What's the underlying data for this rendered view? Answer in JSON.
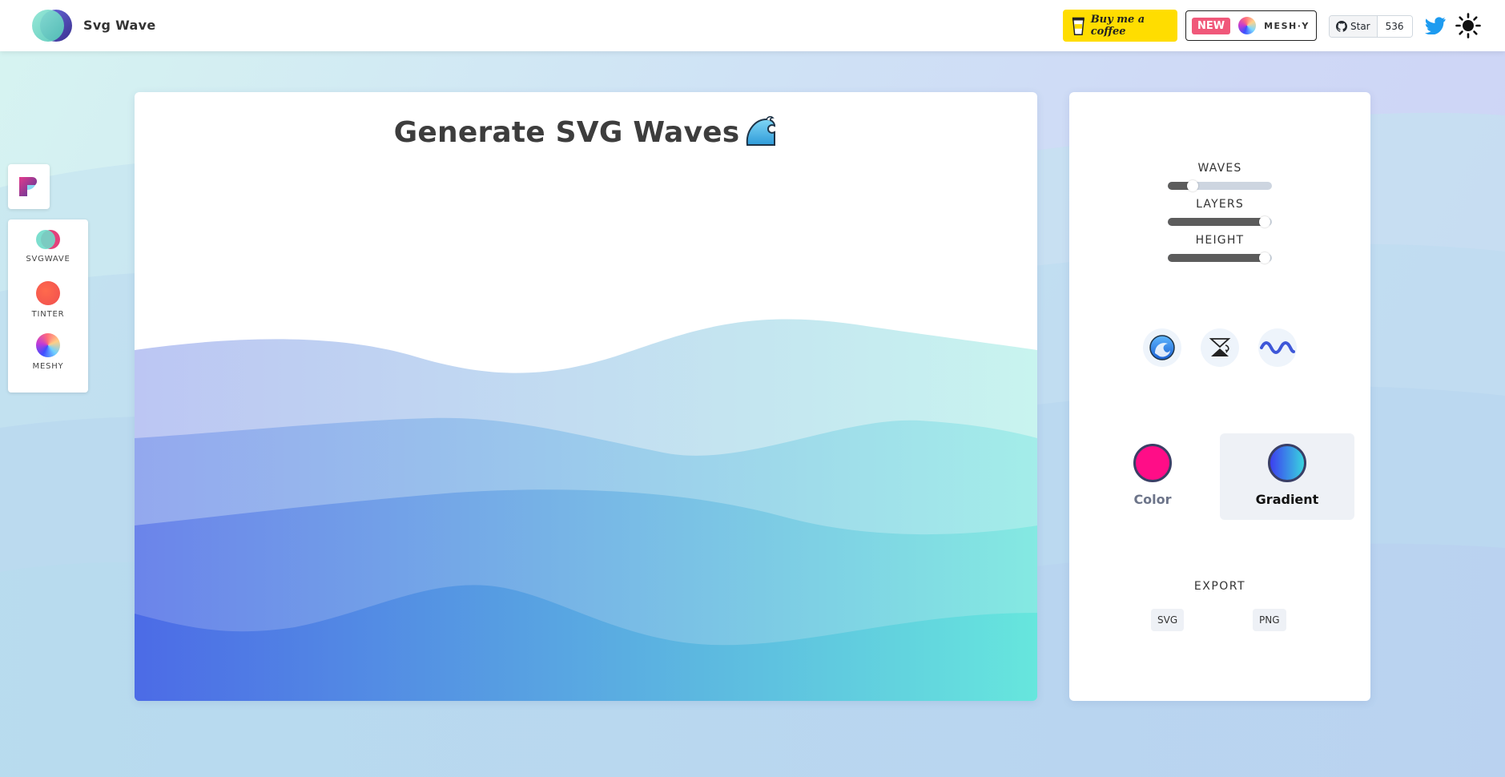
{
  "header": {
    "brand": "Svg Wave",
    "coffee_label": "Buy me a coffee",
    "new_badge": "NEW",
    "mesh_label": "MESH·Y",
    "github_star_label": "Star",
    "github_star_count": "536",
    "icons": [
      "svgwave-logo-icon",
      "coffee-cup-icon",
      "meshy-icon",
      "github-icon",
      "twitter-icon",
      "sun-icon"
    ]
  },
  "sidebar": {
    "items": [
      {
        "label": "SVGWAVE",
        "icon": "svgwave-icon"
      },
      {
        "label": "TINTER",
        "icon": "tinter-icon"
      },
      {
        "label": "MESHY",
        "icon": "meshy-icon"
      }
    ]
  },
  "main": {
    "title": "Generate SVG Waves",
    "wave_gradient": [
      "#4c6be6",
      "#66e6dd"
    ]
  },
  "controls": {
    "sliders": [
      {
        "label": "WAVES",
        "value": 0.2
      },
      {
        "label": "LAYERS",
        "value": 0.9
      },
      {
        "label": "HEIGHT",
        "value": 0.9
      }
    ],
    "tools": [
      "randomize-wave-icon",
      "flip-wave-icon",
      "wave-style-icon"
    ],
    "modes": [
      {
        "label": "Color",
        "active": false,
        "color": "#ff0d87"
      },
      {
        "label": "Gradient",
        "active": true,
        "color_from": "#3c3ff0",
        "color_to": "#39d4df"
      }
    ],
    "export_label": "EXPORT",
    "export_svg": "SVG",
    "export_png": "PNG"
  }
}
